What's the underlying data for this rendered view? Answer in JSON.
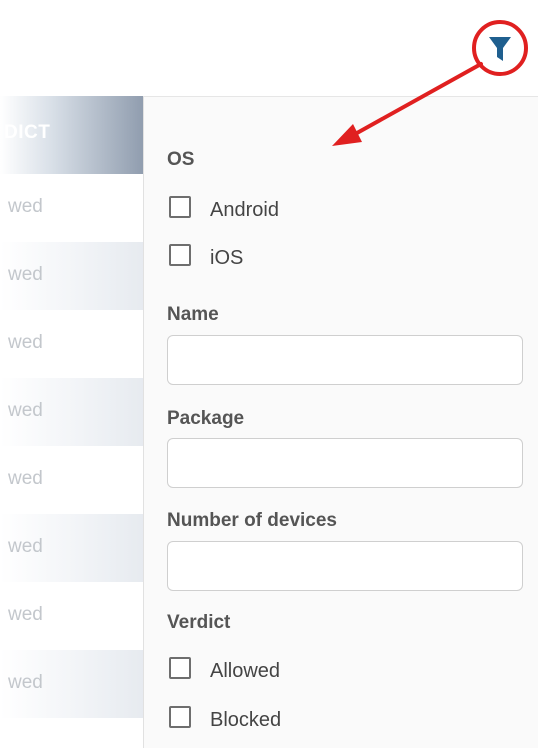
{
  "table": {
    "header": "DICT",
    "rows": [
      "wed",
      "wed",
      "wed",
      "wed",
      "wed",
      "wed",
      "wed",
      "wed"
    ]
  },
  "filter": {
    "os_label": "OS",
    "os_options": [
      "Android",
      "iOS"
    ],
    "name_label": "Name",
    "name_value": "",
    "package_label": "Package",
    "package_value": "",
    "devices_label": "Number of devices",
    "devices_value": "",
    "verdict_label": "Verdict",
    "verdict_options": [
      "Allowed",
      "Blocked"
    ]
  },
  "icons": {
    "filter": "funnel-icon"
  },
  "colors": {
    "funnel": "#1f5f8f",
    "annotation": "#e02020"
  }
}
